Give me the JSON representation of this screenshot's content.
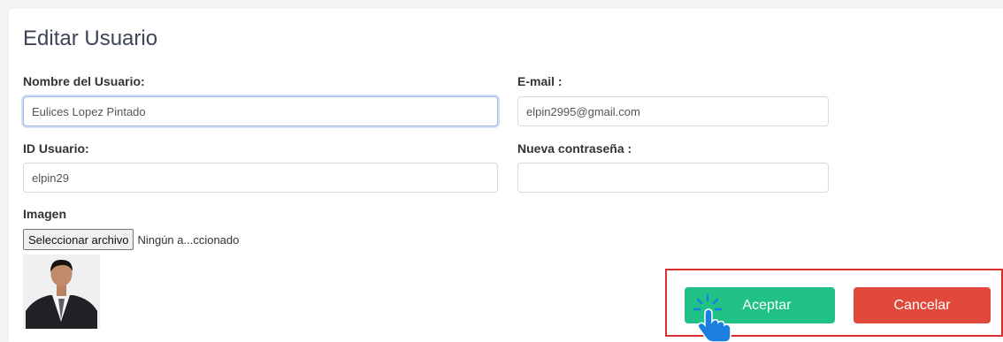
{
  "form": {
    "title": "Editar Usuario",
    "name_label": "Nombre del Usuario:",
    "name_value": "Eulices Lopez Pintado",
    "email_label": "E-mail :",
    "email_value": "elpin2995@gmail.com",
    "id_label": "ID Usuario:",
    "id_value": "elpin29",
    "password_label": "Nueva contraseña :",
    "password_value": "",
    "image_label": "Imagen",
    "file_button": "Seleccionar archivo",
    "file_status": "Ningún a...ccionado"
  },
  "actions": {
    "accept_label": "Aceptar",
    "cancel_label": "Cancelar"
  },
  "colors": {
    "accept": "#1fc186",
    "cancel": "#e0493b",
    "highlight_border": "#d9302f",
    "cursor": "#1a7fe0"
  },
  "icons": {
    "cursor": "hand-pointer-click-icon"
  }
}
